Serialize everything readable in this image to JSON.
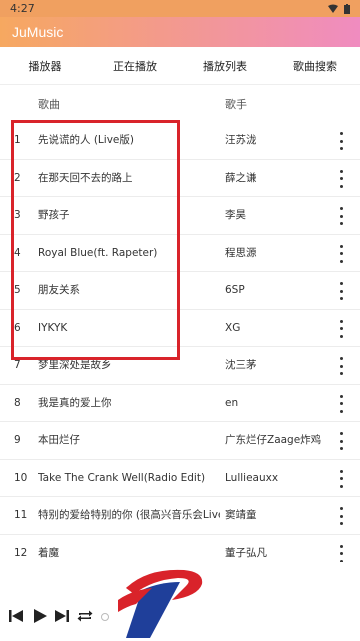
{
  "status": {
    "time": "4:27"
  },
  "app": {
    "title": "JuMusic"
  },
  "tabs": [
    {
      "label": "播放器"
    },
    {
      "label": "正在播放"
    },
    {
      "label": "播放列表"
    },
    {
      "label": "歌曲搜索"
    }
  ],
  "header": {
    "title_col": "歌曲",
    "artist_col": "歌手"
  },
  "songs": [
    {
      "index": "1",
      "title": "先说谎的人 (Live版)",
      "artist": "汪苏泷"
    },
    {
      "index": "2",
      "title": "在那天回不去的路上",
      "artist": "薛之谦"
    },
    {
      "index": "3",
      "title": "野孩子",
      "artist": "李昊"
    },
    {
      "index": "4",
      "title": "Royal Blue(ft. Rapeter)",
      "artist": "程思源"
    },
    {
      "index": "5",
      "title": "朋友关系",
      "artist": "6SP"
    },
    {
      "index": "6",
      "title": "IYKYK",
      "artist": "XG"
    },
    {
      "index": "7",
      "title": "梦里深处是故乡",
      "artist": "沈三茅"
    },
    {
      "index": "8",
      "title": "我是真的爱上你",
      "artist": "en"
    },
    {
      "index": "9",
      "title": "本田烂仔",
      "artist": "广东烂仔Zaage炸鸡"
    },
    {
      "index": "10",
      "title": "Take The Crank Well(Radio Edit)",
      "artist": "Lullieauxx"
    },
    {
      "index": "11",
      "title": "特别的爱给特别的你 (很高兴音乐会Live",
      "artist": "窦靖童"
    },
    {
      "index": "12",
      "title": "着魔",
      "artist": "董子弘凡"
    }
  ],
  "player": {
    "controls": [
      "previous-icon",
      "play-icon",
      "next-icon",
      "repeat-icon"
    ],
    "progress": 0
  },
  "colors": {
    "highlight": "#d9232a",
    "appbar_start": "#f6a860",
    "appbar_end": "#f08cc0"
  }
}
